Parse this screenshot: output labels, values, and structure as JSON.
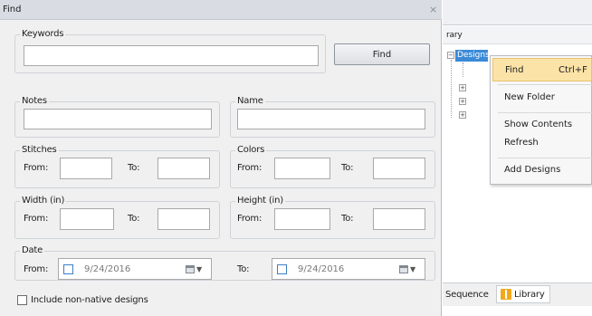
{
  "dialog": {
    "title": "Find",
    "close_glyph": "×",
    "keywords_label": "Keywords",
    "keywords_value": "",
    "find_button": "Find",
    "notes_label": "Notes",
    "name_label": "Name",
    "stitches_label": "Stitches",
    "colors_label": "Colors",
    "width_label": "Width (in)",
    "height_label": "Height (in)",
    "from_label": "From:",
    "to_label": "To:",
    "date_label": "Date",
    "date_from": "9/24/2016",
    "date_to": "9/24/2016",
    "include_label": "Include non-native designs"
  },
  "right_panel": {
    "header_text": "rary",
    "tree_selected": "Designs",
    "context_menu": {
      "find": "Find",
      "find_shortcut": "Ctrl+F",
      "new_folder": "New Folder",
      "show_contents": "Show Contents",
      "refresh": "Refresh",
      "add_designs": "Add Designs"
    },
    "tabs": {
      "sequence": "Sequence",
      "library": "Library"
    }
  }
}
